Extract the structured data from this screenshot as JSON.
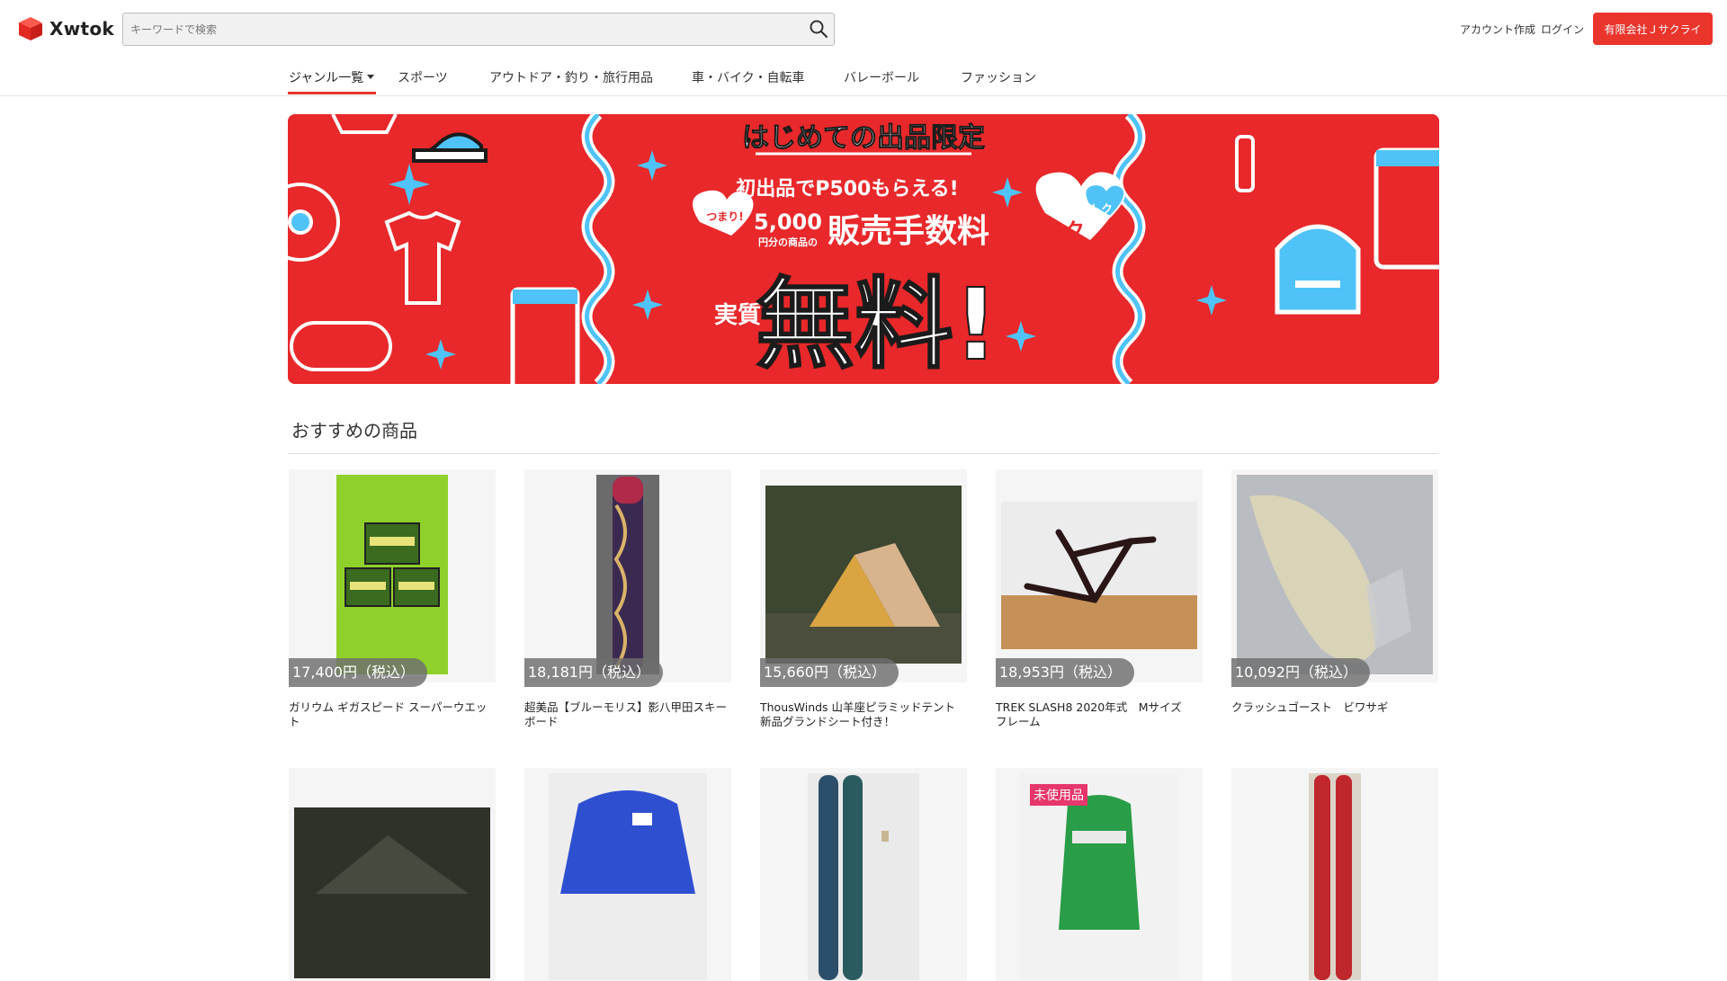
{
  "header": {
    "logo_text": "Xwtok",
    "search_placeholder": "キーワードで検索",
    "account_link": "アカウント作成",
    "login_link": "ログイン",
    "company_button": "有限会社Ｊサクライ"
  },
  "nav": {
    "items": [
      {
        "label": "ジャンル一覧"
      },
      {
        "label": "スポーツ"
      },
      {
        "label": "アウトドア・釣り・旅行用品"
      },
      {
        "label": "車・バイク・自転車"
      },
      {
        "label": "バレーボール"
      },
      {
        "label": "ファッション"
      }
    ]
  },
  "banner": {
    "heading": "はじめての出品限定",
    "line1": "初出品でP500もらえる!",
    "bubble": "つまり!",
    "amount": "5,000",
    "amount_sub": "円分の商品の",
    "fee": "販売手数料",
    "jisshitsu": "実質",
    "free": "無料!",
    "toku": "トク",
    "toku_small": "トク",
    "colors": {
      "bg": "#e8282a",
      "accent": "#4fc3f7"
    }
  },
  "section": {
    "title": "おすすめの商品"
  },
  "products": [
    {
      "price": "17,400円（税込）",
      "title": "ガリウム ギガスピード スーパーウエット"
    },
    {
      "price": "18,181円（税込）",
      "title": "超美品【ブルーモリス】影八甲田スキーボード"
    },
    {
      "price": "15,660円（税込）",
      "title": "ThousWinds 山羊座ピラミッドテント 新品グランドシート付き！"
    },
    {
      "price": "18,953円（税込）",
      "title": "TREK SLASH8 2020年式　Mサイズ　フレーム"
    },
    {
      "price": "10,092円（税込）",
      "title": "クラッシュゴースト　ビワサギ"
    }
  ],
  "products_row2": [
    {
      "badge": ""
    },
    {
      "badge": ""
    },
    {
      "badge": ""
    },
    {
      "badge": "未使用品"
    },
    {
      "badge": ""
    }
  ]
}
